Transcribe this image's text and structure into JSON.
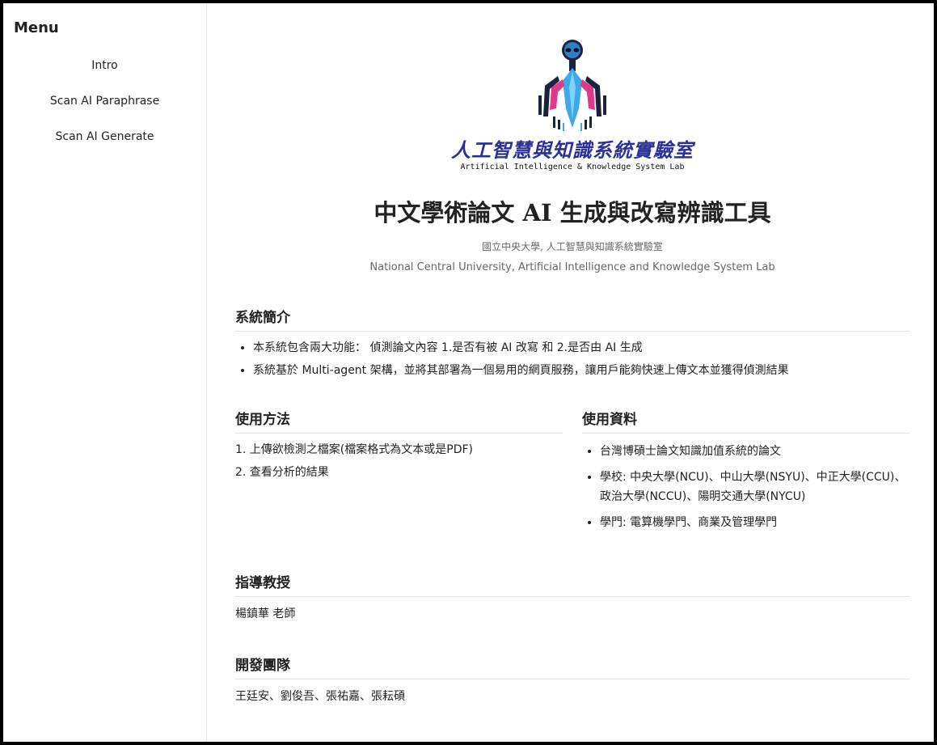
{
  "sidebar": {
    "title": "Menu",
    "items": [
      "Intro",
      "Scan AI Paraphrase",
      "Scan AI Generate"
    ]
  },
  "logo": {
    "cn": "人工智慧與知識系統實驗室",
    "en": "Artificial Intelligence & Knowledge System Lab",
    "colors": {
      "primary": "#2b2f98",
      "accent_cyan": "#3fa8e6",
      "accent_pink": "#e0398c",
      "dark": "#1b2340"
    }
  },
  "header": {
    "title": "中文學術論文 AI 生成與改寫辨識工具",
    "subtitle_cn": "國立中央大學, 人工智慧與知識系統實驗室",
    "subtitle_en": "National Central University, Artificial Intelligence and Knowledge System Lab"
  },
  "intro": {
    "heading": "系統簡介",
    "items": [
      "本系統包含兩大功能： 偵測論文內容 1.是否有被 AI 改寫 和 2.是否由 AI 生成",
      "系統基於 Multi-agent 架構，並將其部署為一個易用的網頁服務，讓用戶能夠快速上傳文本並獲得偵測結果"
    ]
  },
  "usage": {
    "heading": "使用方法",
    "steps": [
      "1. 上傳欲檢測之檔案(檔案格式為文本或是PDF)",
      "2. 查看分析的結果"
    ]
  },
  "dataset": {
    "heading": "使用資料",
    "items": [
      "台灣博碩士論文知識加值系統的論文",
      "學校: 中央大學(NCU)、中山大學(NSYU)、中正大學(CCU)、政治大學(NCCU)、陽明交通大學(NYCU)",
      "學門: 電算機學門、商業及管理學門"
    ]
  },
  "advisor": {
    "heading": "指導教授",
    "name": "楊鎮華 老師"
  },
  "team": {
    "heading": "開發團隊",
    "members": "王廷安、劉俊吾、張祐嘉、張耘碩"
  }
}
